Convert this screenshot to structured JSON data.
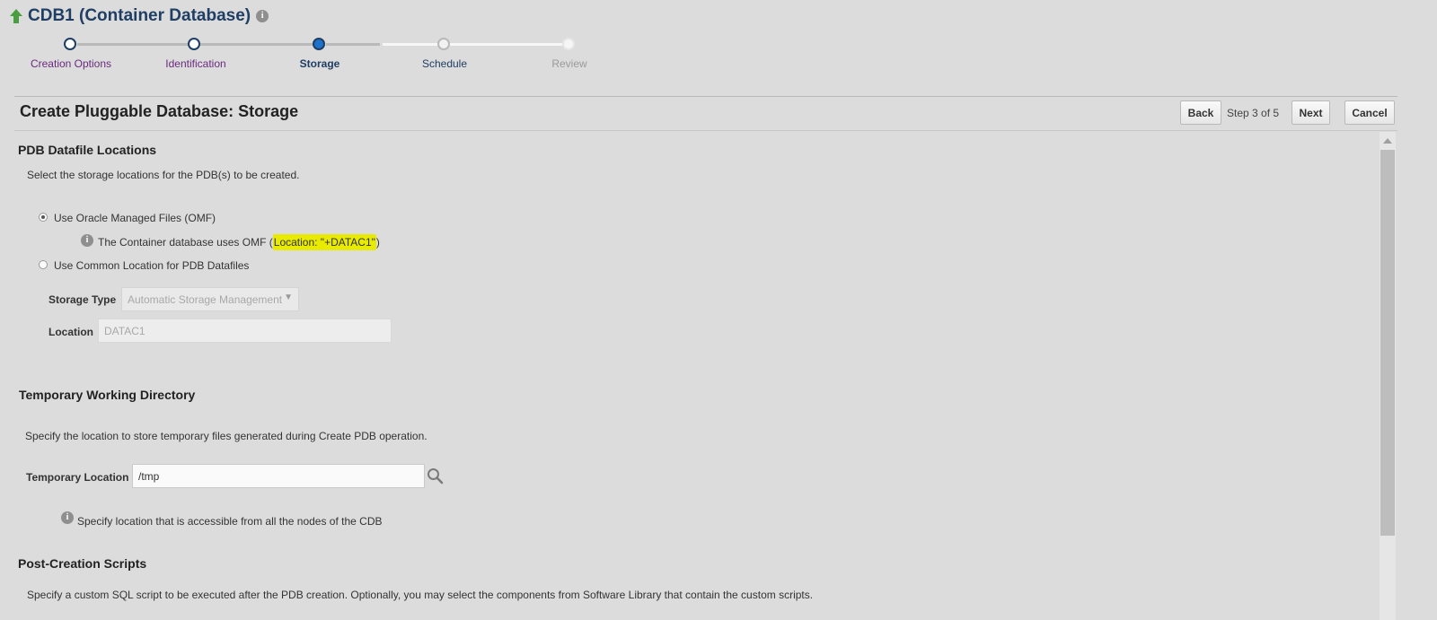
{
  "header": {
    "title": "CDB1 (Container Database)"
  },
  "train": {
    "steps": [
      {
        "label": "Creation Options",
        "state": "visited"
      },
      {
        "label": "Identification",
        "state": "visited"
      },
      {
        "label": "Storage",
        "state": "current"
      },
      {
        "label": "Schedule",
        "state": "next"
      },
      {
        "label": "Review",
        "state": "disabled"
      }
    ]
  },
  "page": {
    "subtitle": "Create Pluggable Database: Storage",
    "back_label": "Back",
    "step_text": "Step 3 of 5",
    "next_label": "Next",
    "cancel_label": "Cancel"
  },
  "pdb_datafile": {
    "heading": "PDB Datafile Locations",
    "description": "Select the storage locations for the PDB(s) to be created.",
    "omf_option": "Use Oracle Managed Files (OMF)",
    "omf_note_prefix": "The Container database uses OMF (",
    "omf_note_location": "Location: \"+DATAC1\"",
    "omf_note_suffix": ")",
    "common_option": "Use Common Location for PDB Datafiles",
    "storage_type_label": "Storage Type",
    "storage_type_value": "Automatic Storage Management",
    "location_label": "Location",
    "location_value": "DATAC1",
    "selected_option": "omf"
  },
  "temp_dir": {
    "heading": "Temporary Working Directory",
    "description": "Specify the location to store temporary files generated during Create PDB operation.",
    "label": "Temporary Location",
    "value": "/tmp",
    "note": "Specify location that is accessible from all the nodes of the CDB"
  },
  "post_scripts": {
    "heading": "Post-Creation Scripts",
    "description": "Specify a custom SQL script to be executed after the PDB creation. Optionally, you may select the components from Software Library that contain the custom scripts."
  },
  "colors": {
    "title": "#1f3e64",
    "train_visited": "#6a2a7e",
    "train_current": "#1f3e64",
    "train_current_dot": "#1d72c9",
    "highlight": "#e8ea00",
    "up_arrow": "#4b9e3f"
  },
  "icons": {
    "title_icon": "up-arrow-icon",
    "info": "info-icon",
    "search": "search-icon",
    "dropdown": "chevron-down-icon"
  }
}
